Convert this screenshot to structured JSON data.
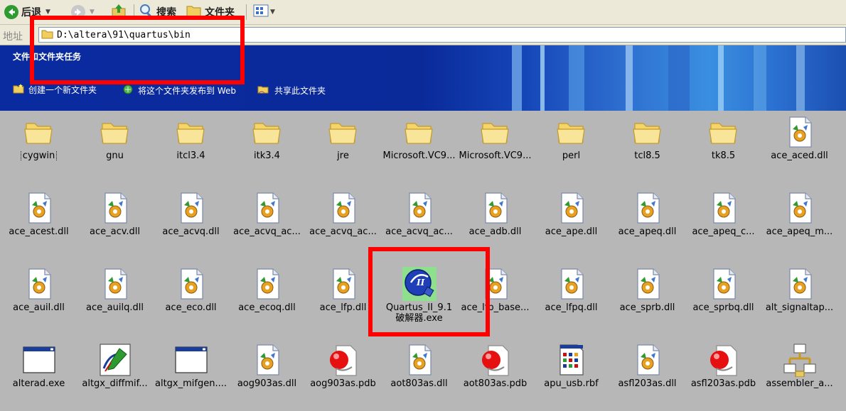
{
  "toolbar": {
    "back_label": "后退",
    "search_label": "搜索",
    "folders_label": "文件夹"
  },
  "address": {
    "label": "地址",
    "path": "D:\\altera\\91\\quartus\\bin"
  },
  "tasks": {
    "title": "文件和文件夹任务",
    "links": [
      "创建一个新文件夹",
      "将这个文件夹发布到 Web",
      "共享此文件夹"
    ]
  },
  "colors": {
    "highlight": "#ff0000",
    "banner": "#0a2aa0",
    "background": "#b7b7b7"
  },
  "files": [
    {
      "name": "cygwin",
      "icon": "folder-icon"
    },
    {
      "name": "gnu",
      "icon": "folder-icon"
    },
    {
      "name": "itcl3.4",
      "icon": "folder-icon"
    },
    {
      "name": "itk3.4",
      "icon": "folder-icon"
    },
    {
      "name": "jre",
      "icon": "folder-icon"
    },
    {
      "name": "Microsoft.VC9...",
      "icon": "folder-icon"
    },
    {
      "name": "Microsoft.VC9...",
      "icon": "folder-icon"
    },
    {
      "name": "perl",
      "icon": "folder-icon"
    },
    {
      "name": "tcl8.5",
      "icon": "folder-icon"
    },
    {
      "name": "tk8.5",
      "icon": "folder-icon"
    },
    {
      "name": "ace_aced.dll",
      "icon": "dll-icon"
    },
    {
      "name": "ace_acest.dll",
      "icon": "dll-icon"
    },
    {
      "name": "ace_acv.dll",
      "icon": "dll-icon"
    },
    {
      "name": "ace_acvq.dll",
      "icon": "dll-icon"
    },
    {
      "name": "ace_acvq_ac...",
      "icon": "dll-icon"
    },
    {
      "name": "ace_acvq_ac...",
      "icon": "dll-icon"
    },
    {
      "name": "ace_acvq_ac...",
      "icon": "dll-icon"
    },
    {
      "name": "ace_adb.dll",
      "icon": "dll-icon"
    },
    {
      "name": "ace_ape.dll",
      "icon": "dll-icon"
    },
    {
      "name": "ace_apeq.dll",
      "icon": "dll-icon"
    },
    {
      "name": "ace_apeq_c...",
      "icon": "dll-icon"
    },
    {
      "name": "ace_apeq_m...",
      "icon": "dll-icon"
    },
    {
      "name": "ace_auil.dll",
      "icon": "dll-icon"
    },
    {
      "name": "ace_auilq.dll",
      "icon": "dll-icon"
    },
    {
      "name": "ace_eco.dll",
      "icon": "dll-icon"
    },
    {
      "name": "ace_ecoq.dll",
      "icon": "dll-icon"
    },
    {
      "name": "ace_lfp.dll",
      "icon": "dll-icon"
    },
    {
      "name": "Quartus_II_9.1 破解器.exe",
      "icon": "quartus-crack-exe-icon"
    },
    {
      "name": "ace_lfp_base...",
      "icon": "dll-icon"
    },
    {
      "name": "ace_lfpq.dll",
      "icon": "dll-icon"
    },
    {
      "name": "ace_sprb.dll",
      "icon": "dll-icon"
    },
    {
      "name": "ace_sprbq.dll",
      "icon": "dll-icon"
    },
    {
      "name": "alt_signaltap...",
      "icon": "dll-icon"
    },
    {
      "name": "alterad.exe",
      "icon": "window-exe-icon"
    },
    {
      "name": "altgx_diffmif...",
      "icon": "pen-exe-icon"
    },
    {
      "name": "altgx_mifgen....",
      "icon": "window-exe-icon"
    },
    {
      "name": "aog903as.dll",
      "icon": "dll-icon"
    },
    {
      "name": "aog903as.pdb",
      "icon": "pdb-icon"
    },
    {
      "name": "aot803as.dll",
      "icon": "dll-icon"
    },
    {
      "name": "aot803as.pdb",
      "icon": "pdb-icon"
    },
    {
      "name": "apu_usb.rbf",
      "icon": "rbf-icon"
    },
    {
      "name": "asfl203as.dll",
      "icon": "dll-icon"
    },
    {
      "name": "asfl203as.pdb",
      "icon": "pdb-icon"
    },
    {
      "name": "assembler_a...",
      "icon": "assembler-icon"
    }
  ]
}
